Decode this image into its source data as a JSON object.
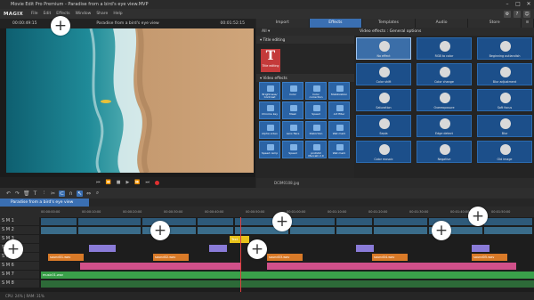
{
  "window": {
    "title": "Movie Edit Pro Premium - Paradise from a bird's eye view.MVP",
    "controls": [
      "–",
      "□",
      "✕"
    ]
  },
  "menubar": {
    "logo": "MAGIX",
    "items": [
      "File",
      "Edit",
      "Effects",
      "Window",
      "Share",
      "Help"
    ]
  },
  "preview": {
    "timecode_left": "00:00:49:15",
    "timecode_right": "00:01:52:15",
    "title": "Paradise from a bird's eye view"
  },
  "media_pool": {
    "tabs": [
      "Import",
      "Effects",
      "Templates",
      "Audio",
      "Store"
    ],
    "active_tab": "Effects",
    "filter": "All",
    "title_section": "Title editing",
    "title_tile_label": "Title editing",
    "video_effects_section": "Video effects",
    "effects": [
      "Brightness/ Contrast",
      "Color",
      "Color correction",
      "Stabilization",
      "Chroma key",
      "Mask",
      "Speed",
      "Art filter",
      "Alpha video",
      "Lens flare",
      "Distortion",
      "Wet mark",
      "Speed ramp",
      "Speed",
      "proDAD Mercalli 2.0",
      "Wet mark"
    ],
    "vfx_header": "Video effects : General options",
    "vfx": [
      "No effect",
      "RGB to color",
      "Beginning outlandish",
      "Color shift",
      "Color change",
      "Blur adjustment",
      "Saturation",
      "Overexposure",
      "Soft focus",
      "Sepia",
      "Edge detect",
      "Blur",
      "Color mosaic",
      "Negative",
      "Old image"
    ],
    "footer_file": "DCIM0108.jpg"
  },
  "timeline": {
    "project_tab": "Paradise from a bird's eye view",
    "ruler_ticks": [
      "00:00:00:00",
      "00:00:10:00",
      "00:00:20:00",
      "00:00:30:00",
      "00:00:40:00",
      "00:00:50:00",
      "00:01:00:00",
      "00:01:10:00",
      "00:01:20:00",
      "00:01:30:00",
      "00:01:40:00",
      "00:01:50:00"
    ],
    "playhead_time": "00:00:49:15",
    "track_labels": [
      "S M 1",
      "S M 2",
      "S M 3",
      "S M 4",
      "S M 5",
      "S M 6",
      "S M 7",
      "S M 8"
    ],
    "clips": {
      "title_clip": "Text",
      "audio": [
        "sound01.wav",
        "sound02.wav",
        "sound03.wav",
        "sound04.wav",
        "sound05.wav"
      ],
      "music": "music01.wav"
    }
  },
  "status": {
    "text": "CPU: 24% | RAM: 31%"
  },
  "colors": {
    "accent": "#3a6fb2",
    "clip_orange": "#d97a28",
    "clip_yellow": "#e8c21a",
    "clip_purple": "#8a7bd8",
    "clip_pink": "#d0508a",
    "audio_green": "#3aa04a"
  },
  "overlays": [
    "+",
    "+",
    "+",
    "+",
    "+",
    "+",
    "+"
  ]
}
